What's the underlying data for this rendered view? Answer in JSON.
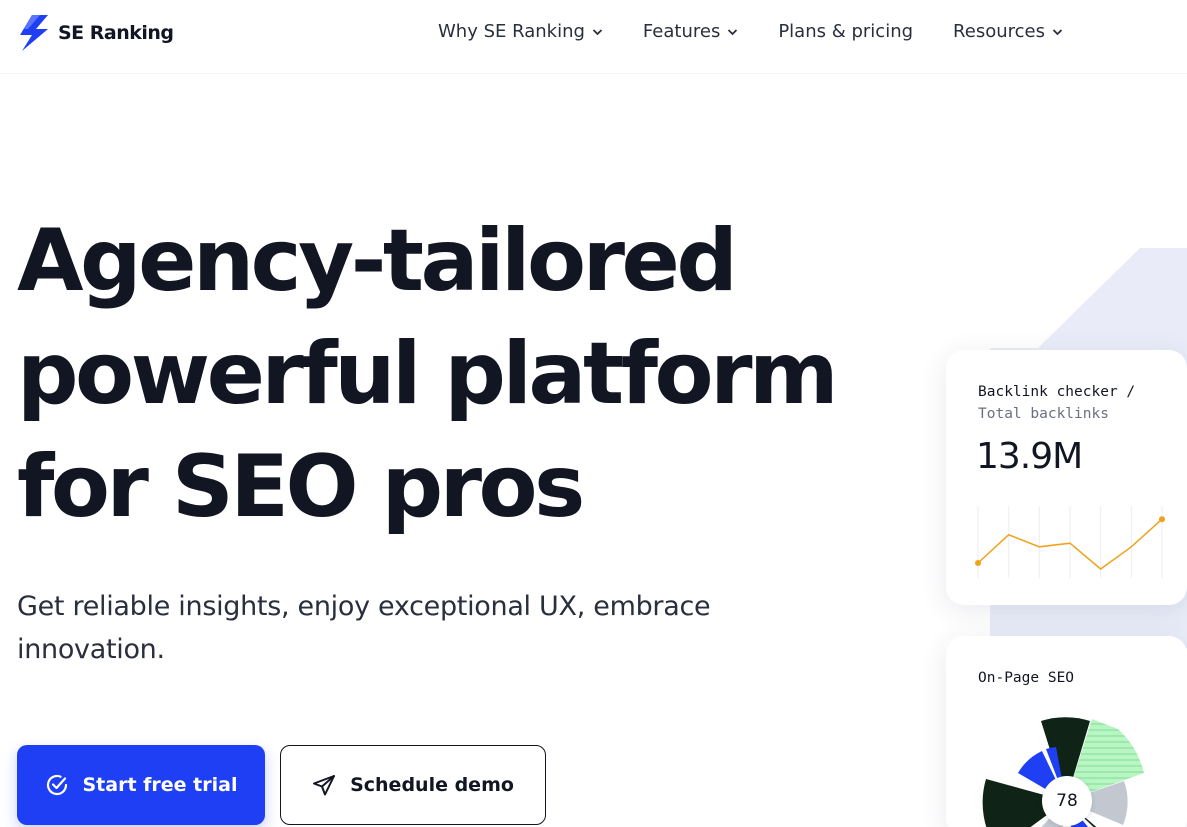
{
  "brand": {
    "name": "SE Ranking",
    "accent": "#1f3ff5"
  },
  "nav": {
    "items": [
      {
        "label": "Why SE Ranking",
        "has_dropdown": true
      },
      {
        "label": "Features",
        "has_dropdown": true
      },
      {
        "label": "Plans & pricing",
        "has_dropdown": false
      },
      {
        "label": "Resources",
        "has_dropdown": true
      }
    ]
  },
  "hero": {
    "title_lines": [
      "Agency-tailored",
      "powerful platform",
      "for SEO pros"
    ],
    "subtitle": "Get reliable insights, enjoy exceptional UX, embrace innovation.",
    "primary_button": {
      "label": "Start free trial",
      "icon": "check-circle-icon"
    },
    "secondary_button": {
      "label": "Schedule demo",
      "icon": "paper-plane-icon"
    }
  },
  "backlink_card": {
    "title": "Backlink checker /",
    "subtitle": "Total backlinks",
    "value": "13.9M",
    "line_color": "#f0a21e",
    "trend": [
      0.15,
      0.62,
      0.42,
      0.48,
      0.05,
      0.42,
      0.88
    ]
  },
  "onpage_card": {
    "title": "On-Page SEO",
    "score": "78"
  }
}
